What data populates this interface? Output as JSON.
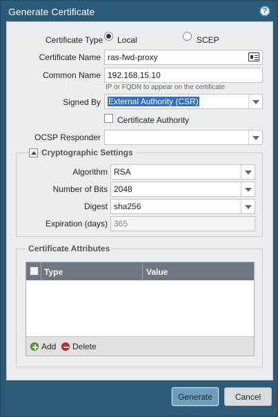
{
  "dialog": {
    "title": "Generate Certificate",
    "help_icon": "help-icon",
    "help_glyph": "?"
  },
  "form": {
    "cert_type_label": "Certificate Type",
    "cert_type_options": [
      "Local",
      "SCEP"
    ],
    "cert_type_selected": "Local",
    "cert_name_label": "Certificate Name",
    "cert_name_value": "ras-fwd-proxy",
    "common_name_label": "Common Name",
    "common_name_value": "192.168.15.10",
    "common_name_hint": "IP or FQDN to appear on the certificate",
    "signed_by_label": "Signed By",
    "signed_by_value": "External Authority (CSR)",
    "cert_authority_label": "Certificate Authority",
    "cert_authority_checked": false,
    "ocsp_label": "OCSP Responder",
    "ocsp_value": ""
  },
  "crypto": {
    "legend": "Cryptographic Settings",
    "algorithm_label": "Algorithm",
    "algorithm_value": "RSA",
    "bits_label": "Number of Bits",
    "bits_value": "2048",
    "digest_label": "Digest",
    "digest_value": "sha256",
    "expiration_label": "Expiration (days)",
    "expiration_value": "365"
  },
  "attributes": {
    "legend": "Certificate Attributes",
    "columns": [
      "Type",
      "Value"
    ],
    "rows": [],
    "add_label": "Add",
    "delete_label": "Delete"
  },
  "footer": {
    "generate_label": "Generate",
    "cancel_label": "Cancel"
  },
  "colors": {
    "frame": "#2a5b78",
    "panel": "#ecedee",
    "grid_header": "#6f7780",
    "selection": "#2f6fc8",
    "primary_button": "#6b9fbd"
  }
}
